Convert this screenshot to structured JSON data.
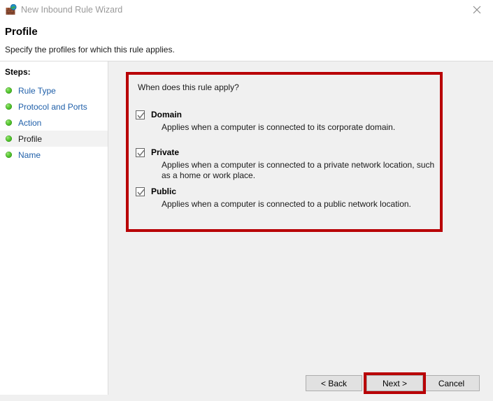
{
  "window": {
    "title": "New Inbound Rule Wizard",
    "icon": "firewall-brick-globe-icon",
    "close_label": "✕"
  },
  "header": {
    "title": "Profile",
    "subtitle": "Specify the profiles for which this rule applies."
  },
  "sidebar": {
    "heading": "Steps:",
    "items": [
      {
        "label": "Rule Type",
        "active": false
      },
      {
        "label": "Protocol and Ports",
        "active": false
      },
      {
        "label": "Action",
        "active": false
      },
      {
        "label": "Profile",
        "active": true
      },
      {
        "label": "Name",
        "active": false
      }
    ]
  },
  "main": {
    "question": "When does this rule apply?",
    "options": [
      {
        "label": "Domain",
        "checked": true,
        "description": "Applies when a computer is connected to its corporate domain."
      },
      {
        "label": "Private",
        "checked": true,
        "description": "Applies when a computer is connected to a private network location, such as a home or work place."
      },
      {
        "label": "Public",
        "checked": true,
        "description": "Applies when a computer is connected to a public network location."
      }
    ]
  },
  "footer": {
    "back_label": "< Back",
    "next_label": "Next >",
    "cancel_label": "Cancel"
  },
  "annotations": {
    "highlight_color": "#b80005",
    "targets": [
      "profile-options-panel",
      "next-button"
    ]
  }
}
